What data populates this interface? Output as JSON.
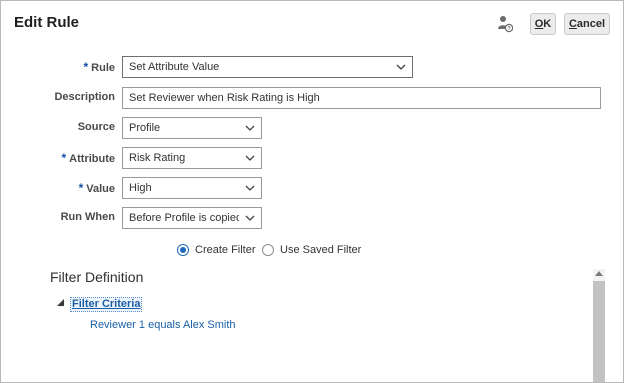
{
  "dialog": {
    "title": "Edit Rule",
    "ok_label_mnemonic": "O",
    "ok_label_rest": "K",
    "cancel_label_mnemonic": "C",
    "cancel_label_rest": "ancel",
    "help_icon": "person-help-icon"
  },
  "form": {
    "rule": {
      "label": "Rule",
      "required": "*",
      "value": "Set Attribute Value"
    },
    "description": {
      "label": "Description",
      "value": "Set Reviewer when Risk Rating is High"
    },
    "source": {
      "label": "Source",
      "value": "Profile"
    },
    "attribute": {
      "label": "Attribute",
      "required": "*",
      "value": "Risk Rating"
    },
    "value": {
      "label": "Value",
      "required": "*",
      "value": "High"
    },
    "run_when": {
      "label": "Run When",
      "value": "Before Profile is copied to"
    }
  },
  "filter_mode": {
    "options": [
      {
        "label": "Create Filter",
        "selected": true
      },
      {
        "label": "Use Saved Filter",
        "selected": false
      }
    ]
  },
  "filter_definition": {
    "title": "Filter Definition",
    "root_label": "Filter Criteria",
    "expanded": true,
    "children": [
      "Reviewer 1 equals Alex Smith"
    ]
  },
  "colors": {
    "accent": "#1b6bb8",
    "link": "#1a5fa6",
    "required_marker": "#0f4fa8"
  }
}
